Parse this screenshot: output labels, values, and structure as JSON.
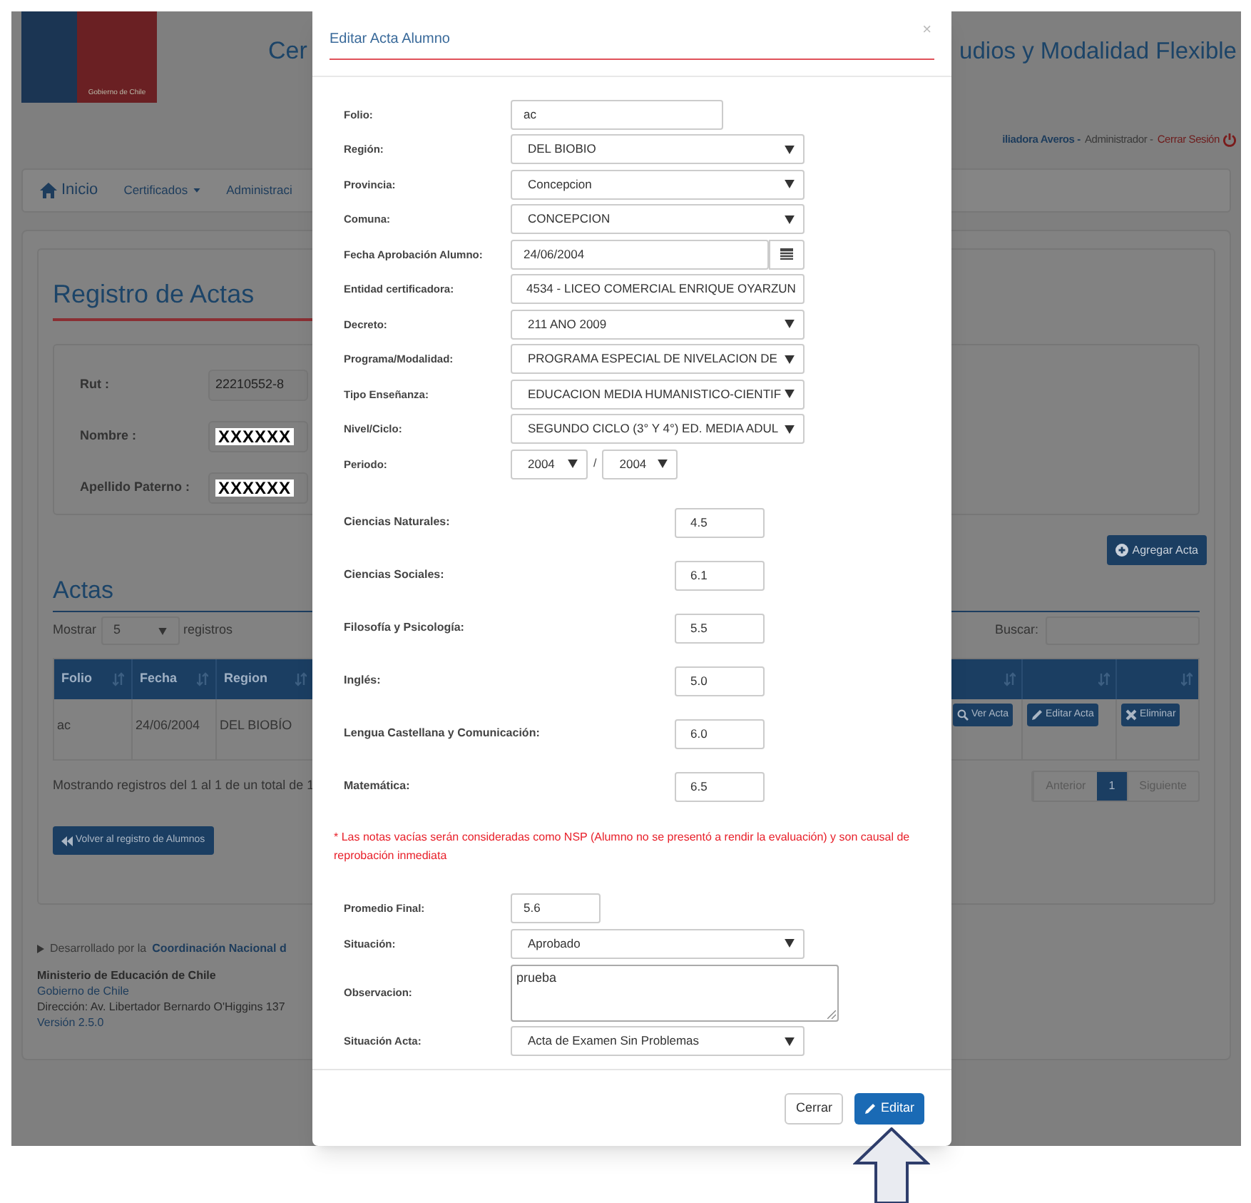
{
  "header": {
    "logo_text": "Gobierno de Chile",
    "title_left": "Cer",
    "title_right": "udios y Modalidad Flexible"
  },
  "user_bar": {
    "user": "iliadora Averos -",
    "role": "Administrador -",
    "logout": "Cerrar Sesión"
  },
  "nav": [
    {
      "label": "Inicio",
      "kind": "home"
    },
    {
      "label": "Certificados",
      "kind": "dropdown"
    },
    {
      "label": "Administraci",
      "kind": "plain"
    }
  ],
  "registro": {
    "title": "Registro de Actas",
    "fields": [
      {
        "label": "Rut :",
        "value": "22210552-8",
        "kind": "text"
      },
      {
        "label": "Nombre :",
        "value": "XXXXXX",
        "kind": "masked"
      },
      {
        "label": "Apellido Paterno :",
        "value": "XXXXXX",
        "kind": "masked"
      }
    ]
  },
  "actas": {
    "title": "Actas",
    "add_button": "Agregar Acta",
    "show_label": "Mostrar",
    "page_size": "5",
    "records_label": "registros",
    "search_label": "Buscar:",
    "table": {
      "columns": [
        "Folio",
        "Fecha",
        "Region"
      ],
      "rows": [
        {
          "cells": [
            "ac",
            "24/06/2004",
            "DEL BIOBÍO"
          ],
          "actions": [
            {
              "label": "Ver Acta",
              "kind": "view"
            },
            {
              "label": "Editar Acta",
              "kind": "edit"
            },
            {
              "label": "Eliminar",
              "kind": "delete"
            }
          ]
        }
      ]
    },
    "info": "Mostrando registros del 1 al 1 de un total de 1",
    "pagination": [
      {
        "label": "Anterior",
        "selected": false
      },
      {
        "label": "1",
        "selected": true
      },
      {
        "label": "Siguiente",
        "selected": false
      }
    ],
    "back_button": "Volver al registro de Alumnos"
  },
  "footer": {
    "developed_prefix": "Desarrollado por la",
    "developed_link": "Coordinación Nacional d",
    "ministry": "Ministerio de Educación de Chile",
    "gov_link": "Gobierno de Chile",
    "address": "Dirección: Av. Libertador Bernardo O'Higgins 137",
    "version": "Versión 2.5.0"
  },
  "modal": {
    "title": "Editar Acta Alumno",
    "close": "×",
    "fields": [
      {
        "label": "Folio:",
        "kind": "text",
        "value": "ac"
      },
      {
        "label": "Región:",
        "kind": "select",
        "value": "DEL BIOBIO"
      },
      {
        "label": "Provincia:",
        "kind": "select",
        "value": "Concepcion"
      },
      {
        "label": "Comuna:",
        "kind": "select",
        "value": "CONCEPCION"
      },
      {
        "label": "Fecha Aprobación Alumno:",
        "kind": "date",
        "value": "24/06/2004"
      },
      {
        "label": "Entidad certificadora:",
        "kind": "wide",
        "value": "4534 - LICEO COMERCIAL ENRIQUE OYARZUN"
      },
      {
        "label": "Decreto:",
        "kind": "select",
        "value": "211 ANO 2009"
      },
      {
        "label": "Programa/Modalidad:",
        "kind": "select",
        "value": "PROGRAMA ESPECIAL DE NIVELACION DE"
      },
      {
        "label": "Tipo Enseñanza:",
        "kind": "select",
        "value": "EDUCACION MEDIA HUMANISTICO-CIENTIF"
      },
      {
        "label": "Nivel/Ciclo:",
        "kind": "select",
        "value": "SEGUNDO CICLO (3° Y 4°) ED. MEDIA ADUL"
      },
      {
        "label": "Periodo:",
        "kind": "period",
        "value": "2004",
        "separator": "/",
        "value_end": "2004"
      }
    ],
    "grades": [
      {
        "label": "Ciencias Naturales:",
        "value": "4.5"
      },
      {
        "label": "Ciencias Sociales:",
        "value": "6.1"
      },
      {
        "label": "Filosofía y Psicología:",
        "value": "5.5"
      },
      {
        "label": "Inglés:",
        "value": "5.0"
      },
      {
        "label": "Lengua Castellana y Comunicación:",
        "value": "6.0"
      },
      {
        "label": "Matemática:",
        "value": "6.5"
      }
    ],
    "note": "* Las notas vacías serán consideradas como NSP (Alumno no se presentó a rendir la evaluación) y son causal de reprobación inmediata",
    "summary": [
      {
        "label": "Promedio Final:",
        "kind": "text",
        "value": "5.6"
      },
      {
        "label": "Situación:",
        "kind": "select",
        "value": "Aprobado"
      },
      {
        "label": "Observacion:",
        "kind": "textarea",
        "value": "prueba"
      },
      {
        "label": "Situación Acta:",
        "kind": "select",
        "value": "Acta de Examen Sin Problemas"
      }
    ],
    "buttons": [
      {
        "label": "Cerrar",
        "kind": "default"
      },
      {
        "label": "Editar",
        "kind": "primary"
      }
    ]
  }
}
